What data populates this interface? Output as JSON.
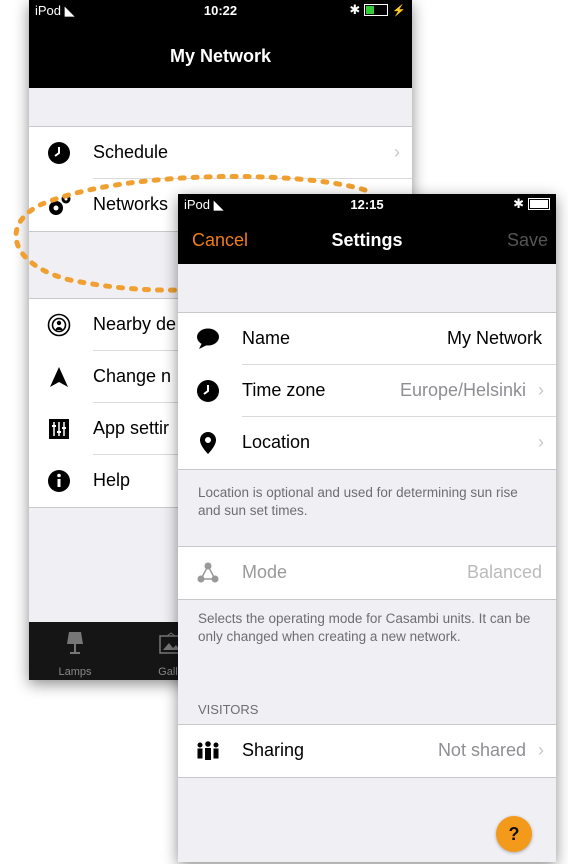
{
  "back_screen": {
    "status": {
      "carrier": "iPod",
      "time": "10:22"
    },
    "title": "My Network",
    "menu_group1": [
      {
        "label": "Schedule",
        "icon": "clock-icon"
      },
      {
        "label": "Networks",
        "icon": "gears-icon"
      }
    ],
    "menu_group2": [
      {
        "label": "Nearby de",
        "icon": "broadcast-icon"
      },
      {
        "label": "Change n",
        "icon": "arrow-icon"
      },
      {
        "label": "App settir",
        "icon": "sliders-icon"
      },
      {
        "label": "Help",
        "icon": "info-icon"
      }
    ],
    "tabs": [
      {
        "label": "Lamps",
        "icon": "lamp-icon"
      },
      {
        "label": "Galle",
        "icon": "gallery-icon"
      }
    ]
  },
  "front_screen": {
    "status": {
      "carrier": "iPod",
      "time": "12:15"
    },
    "nav": {
      "cancel": "Cancel",
      "title": "Settings",
      "save": "Save"
    },
    "general": [
      {
        "label": "Name",
        "value": "My Network",
        "icon": "speech-bubble-icon"
      },
      {
        "label": "Time zone",
        "value": "Europe/Helsinki",
        "icon": "clock-icon"
      },
      {
        "label": "Location",
        "value": "",
        "icon": "map-pin-icon"
      }
    ],
    "location_note": "Location is optional and used for determining sun rise and sun set times.",
    "mode": {
      "label": "Mode",
      "value": "Balanced",
      "icon": "network-nodes-icon"
    },
    "mode_note": "Selects the operating mode for Casambi units. It can be only changed when creating a new network.",
    "visitors_header": "VISITORS",
    "sharing": {
      "label": "Sharing",
      "value": "Not shared",
      "icon": "people-icon"
    },
    "help_label": "?"
  },
  "colors": {
    "accent": "#f07d1a",
    "help_button": "#f49a1a",
    "dash": "#f0a030"
  }
}
